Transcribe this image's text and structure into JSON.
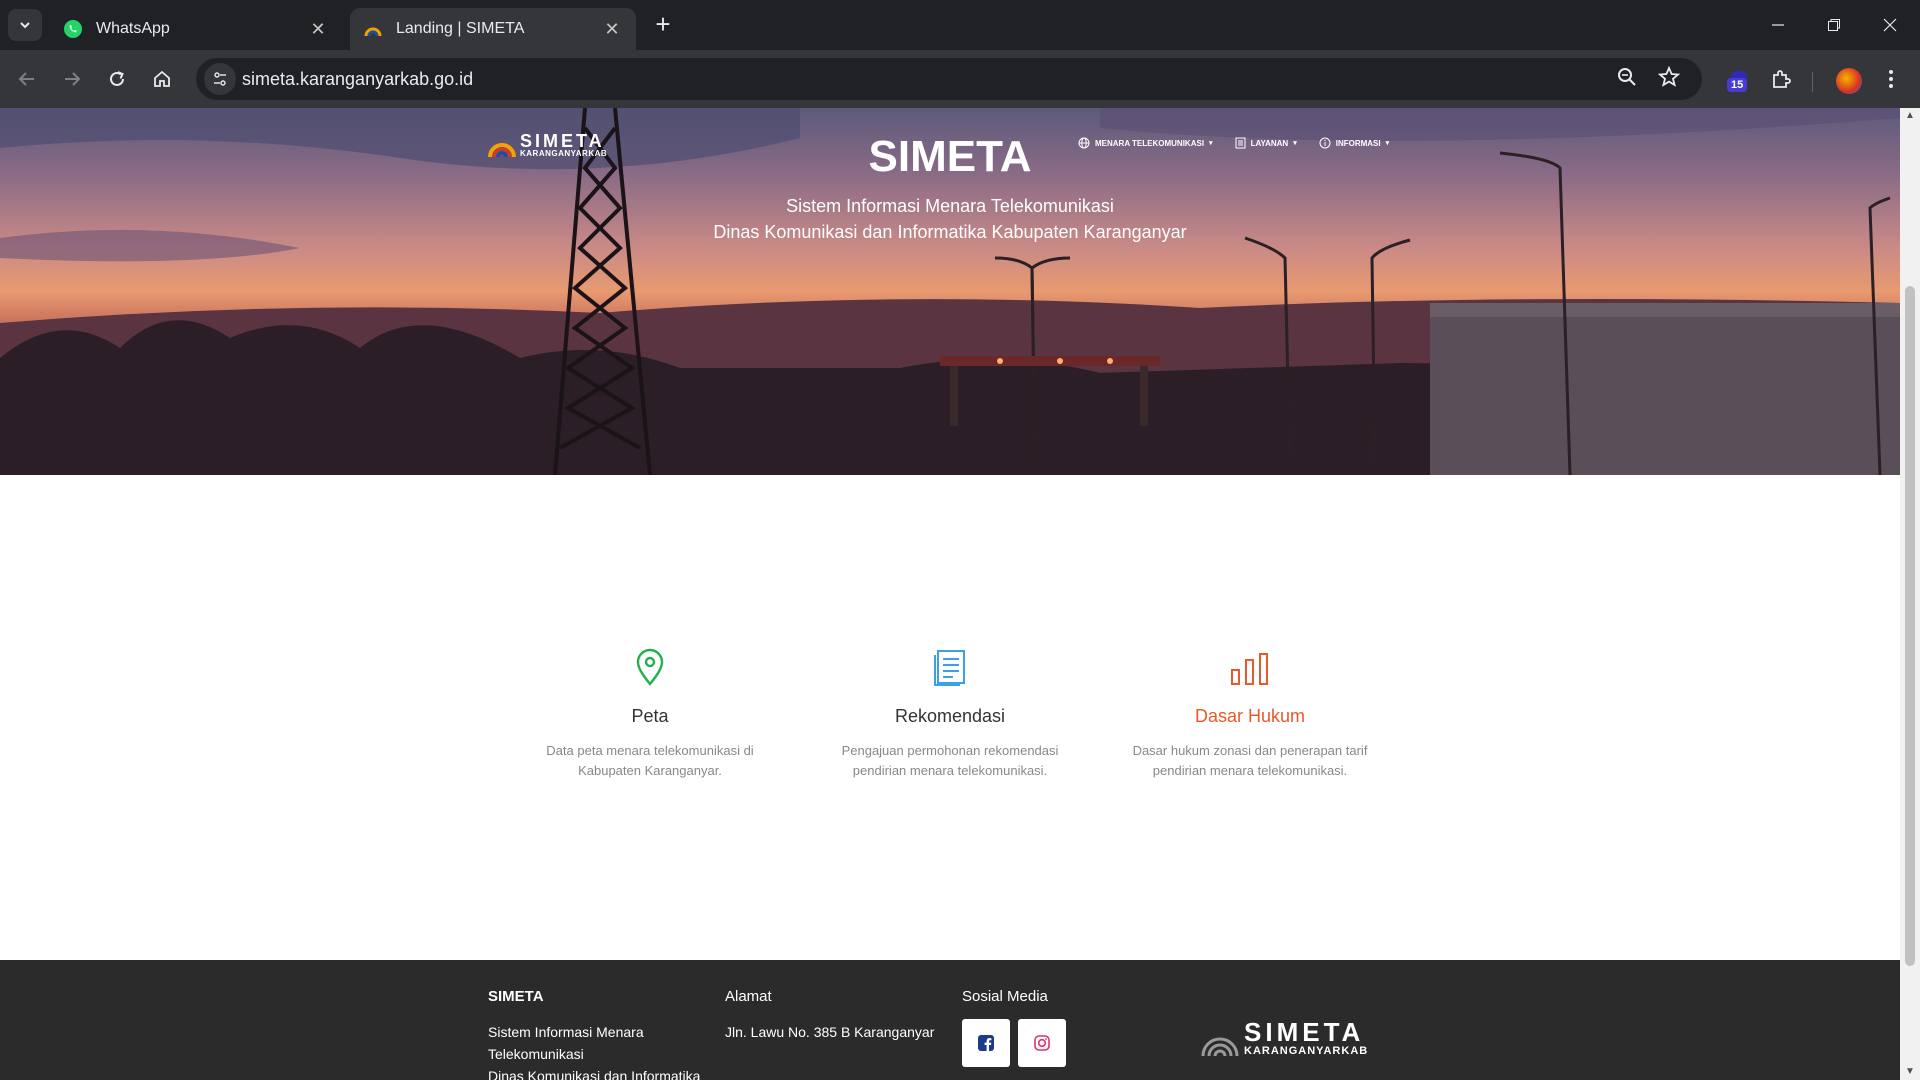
{
  "browser": {
    "tabs": [
      {
        "title": "WhatsApp",
        "icon": "whatsapp-icon",
        "active": false
      },
      {
        "title": "Landing | SIMETA",
        "icon": "simeta-favicon",
        "active": true
      }
    ],
    "url": "simeta.karanganyarkab.go.id",
    "extension_badge": "15"
  },
  "hero": {
    "logo_title": "SIMETA",
    "logo_subtitle": "KARANGANYARKAB",
    "title": "SIMETA",
    "subtitle_line1": "Sistem Informasi Menara Telekomunikasi",
    "subtitle_line2": "Dinas Komunikasi dan Informatika Kabupaten Karanganyar",
    "nav": [
      {
        "label": "MENARA TELEKOMUNIKASI",
        "icon": "globe-icon"
      },
      {
        "label": "LAYANAN",
        "icon": "document-icon"
      },
      {
        "label": "INFORMASI",
        "icon": "info-icon"
      }
    ]
  },
  "features": [
    {
      "title": "Peta",
      "desc": "Data peta menara telekomunikasi di Kabupaten Karanganyar.",
      "icon": "map-pin-icon",
      "color": "#22b14c"
    },
    {
      "title": "Rekomendasi",
      "desc": "Pengajuan permohonan rekomendasi pendirian menara telekomunikasi.",
      "icon": "document-icon",
      "color": "#3aa0e8"
    },
    {
      "title": "Dasar Hukum",
      "desc": "Dasar hukum zonasi dan penerapan tarif pendirian menara telekomunikasi.",
      "icon": "bar-chart-icon",
      "color": "#e8592b"
    }
  ],
  "footer": {
    "col1_title": "SIMETA",
    "col1_line1": "Sistem Informasi Menara",
    "col1_line2": "Telekomunikasi",
    "col1_line3": "Dinas Komunikasi dan Informatika",
    "col2_title": "Alamat",
    "col2_text": "Jln. Lawu No. 385 B Karanganyar",
    "col3_title": "Sosial Media",
    "logo_title": "SIMETA",
    "logo_subtitle": "KARANGANYARKAB"
  }
}
